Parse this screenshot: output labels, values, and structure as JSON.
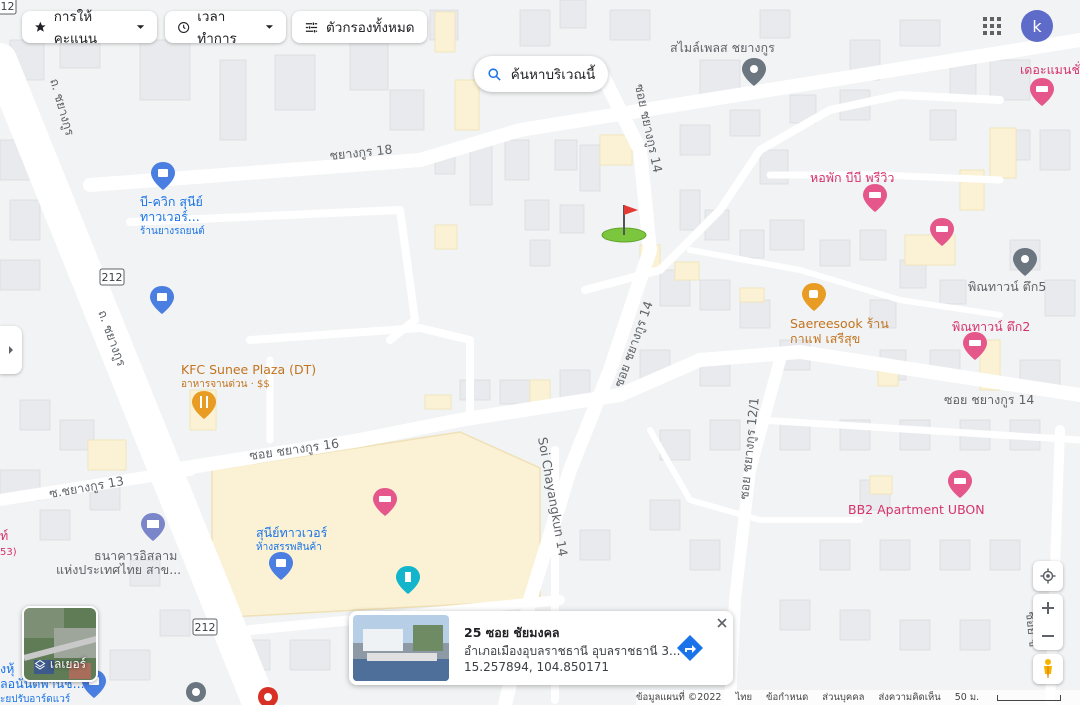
{
  "filters": {
    "rating": "การให้คะแนน",
    "hours": "เวลาทำการ",
    "all_filters": "ตัวกรองทั้งหมด"
  },
  "search_area": "ค้นหาบริเวณนี้",
  "account_initial": "k",
  "layers_label": "เลเยอร์",
  "roads": {
    "chayangkun_main_upper": "ถ. ชยางกูร",
    "chayangkun_main_lower": "ถ. ชยางกูร",
    "route_212_a": "212",
    "route_212_b": "212",
    "route_212_c": "212",
    "chayangkun_18": "ชยางกูร 18",
    "soi_14_upper": "ซอย ชยางกูร 14",
    "soi_14_mid": "ซอย ชยางกูร 14",
    "soi_14_right": "ซอย ชยางกูร 14",
    "soi_16": "ซอย ชยางกูร 16",
    "soi_13": "ซ.ชยางกูร 13",
    "soi_12_1": "ซอย ชยางกูร 12/1",
    "soi_chayangkun_14_en": "Soi Chayangkun 14",
    "soi_right_edge": "ซอย ช"
  },
  "places": {
    "smile_place": "สไมล์เพลส ชยางกูร",
    "the_mansion": "เดอะแมนชั่",
    "b_quik_name_1": "บี-ควิก สุนีย์",
    "b_quik_name_2": "ทาวเวอร์...",
    "b_quik_sub": "ร้านยางรถยนต์",
    "dorm_bb": "หอพัก บีบี พรีวิว",
    "phinnathown_5": "พิณทาวน์ ตึก5",
    "saereesook_1": "Saereesook ร้าน",
    "saereesook_2": "กาแฟ เสรีสุข",
    "phinnathown_2": "พิณทาวน์ ตึก2",
    "kfc_name": "KFC Sunee Plaza (DT)",
    "kfc_sub": "อาหารจานด่วน · $$",
    "sunee_tower": "สุนีย์ทาวเวอร์",
    "sunee_tower_sub": "ห้างสรรพสินค้า",
    "bb2": "BB2 Apartment UBON",
    "bank_1": "ธนาคารอิสลาม",
    "bank_2": "แห่งประเทศไทย สาข...",
    "left_cut_1": "ท์",
    "left_cut_2": "53)",
    "bottom_left_1": "งหุ้",
    "bottom_left_2": "ลอนันตพานิช...",
    "bottom_left_3": "ะยปรับอาร์ดแวร์"
  },
  "selected_place": {
    "title": "25 ซอย ชัยมงคล",
    "address": "อำเภอเมืองอุบลราชธานี อุบลราชธานี 3...",
    "coordinates": "15.257894, 104.850171"
  },
  "footer": {
    "map_data": "ข้อมูลแผนที่ ©2022",
    "language": "ไทย",
    "terms": "ข้อกำหนด",
    "privacy": "ส่วนบุคคล",
    "feedback": "ส่งความคิดเห็น",
    "scale": "50 ม."
  },
  "colors": {
    "road_label": "#5f6368",
    "place_orange": "#c2741f",
    "place_pink": "#d6336c",
    "place_blue": "#1a73e8",
    "mall_fill": "#fbf2d6"
  }
}
